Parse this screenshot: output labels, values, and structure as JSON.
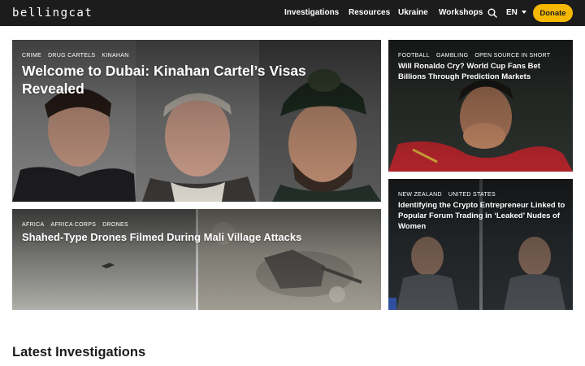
{
  "header": {
    "logo_text": "bellingcat",
    "nav": [
      "Investigations",
      "Resources",
      "Ukraine",
      "Workshops"
    ],
    "language": "EN",
    "donate_label": "Donate",
    "colors": {
      "background": "#1c1c1c",
      "donate": "#f5b800"
    }
  },
  "icons": {
    "search": "search-icon",
    "language_caret": "chevron-down-icon"
  },
  "featured": [
    {
      "tags": [
        "CRIME",
        "DRUG CARTELS",
        "KINAHAN"
      ],
      "title": "Welcome to Dubai: Kinahan Cartel’s Visas Revealed"
    },
    {
      "tags": [
        "AFRICA",
        "AFRICA CORPS",
        "DRONES"
      ],
      "title": "Shahed-Type Drones Filmed During Mali Village Attacks"
    },
    {
      "tags": [
        "FOOTBALL",
        "GAMBLING",
        "OPEN SOURCE IN SHORT"
      ],
      "title": "Will Ronaldo Cry? World Cup Fans Bet Billions Through Prediction Markets"
    },
    {
      "tags": [
        "NEW ZEALAND",
        "UNITED STATES"
      ],
      "title": "Identifying the Crypto Entrepreneur Linked to Popular Forum Trading in ‘Leaked’ Nudes of Women"
    }
  ],
  "latest": {
    "heading": "Latest Investigations"
  }
}
